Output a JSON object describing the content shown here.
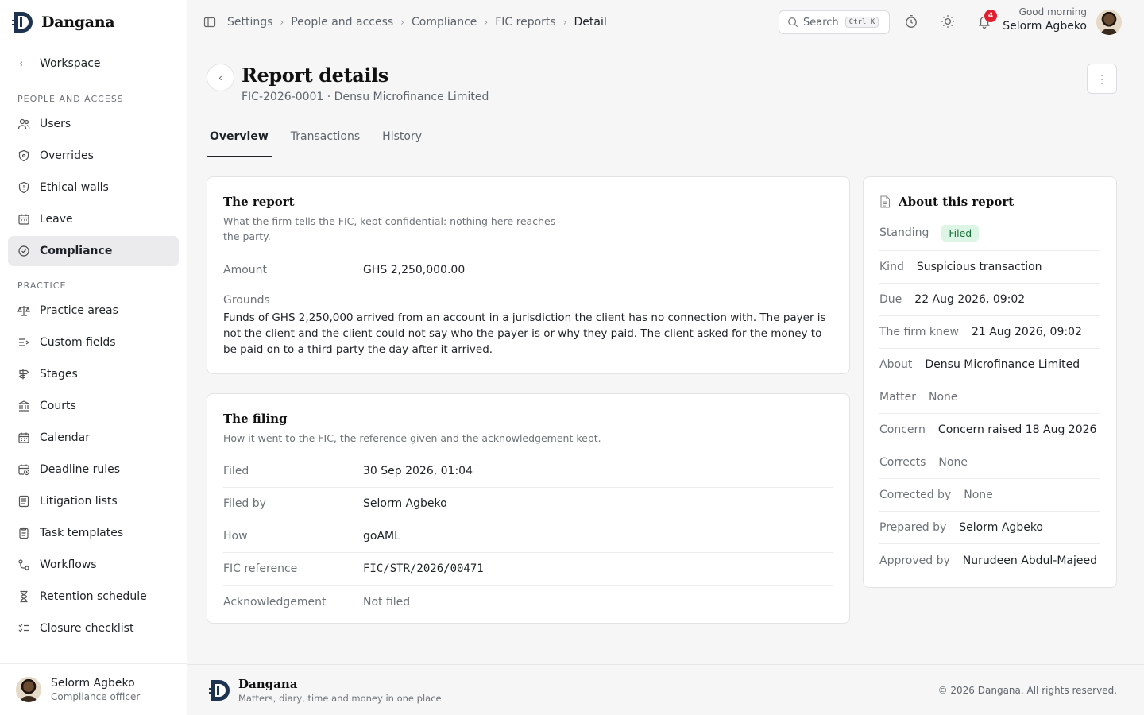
{
  "app": {
    "brand": "Dangana",
    "tagline": "Matters, diary, time and money in one place",
    "copyright": "© 2026 Dangana. All rights reserved."
  },
  "sidebar": {
    "back_label": "Workspace",
    "sections": [
      {
        "label": "PEOPLE AND ACCESS",
        "items": [
          {
            "label": "Users",
            "icon": "users-icon"
          },
          {
            "label": "Overrides",
            "icon": "shield-icon"
          },
          {
            "label": "Ethical walls",
            "icon": "shield-alert-icon"
          },
          {
            "label": "Leave",
            "icon": "calendar-icon"
          },
          {
            "label": "Compliance",
            "icon": "check-circle-icon",
            "active": true
          }
        ]
      },
      {
        "label": "PRACTICE",
        "items": [
          {
            "label": "Practice areas",
            "icon": "scales-icon"
          },
          {
            "label": "Custom fields",
            "icon": "form-icon"
          },
          {
            "label": "Stages",
            "icon": "signpost-icon"
          },
          {
            "label": "Courts",
            "icon": "landmark-icon"
          },
          {
            "label": "Calendar",
            "icon": "calendar-icon"
          },
          {
            "label": "Deadline rules",
            "icon": "calendar-clock-icon"
          },
          {
            "label": "Litigation lists",
            "icon": "list-icon"
          },
          {
            "label": "Task templates",
            "icon": "clipboard-icon"
          },
          {
            "label": "Workflows",
            "icon": "workflow-icon"
          },
          {
            "label": "Retention schedule",
            "icon": "hourglass-icon"
          },
          {
            "label": "Closure checklist",
            "icon": "checklist-icon"
          }
        ]
      }
    ],
    "user": {
      "name": "Selorm Agbeko",
      "role": "Compliance officer"
    }
  },
  "topbar": {
    "breadcrumbs": [
      "Settings",
      "People and access",
      "Compliance",
      "FIC reports",
      "Detail"
    ],
    "search_label": "Search",
    "search_shortcut": "Ctrl K",
    "notifications_count": "4",
    "greeting": "Good morning",
    "user_name": "Selorm Agbeko"
  },
  "page": {
    "title": "Report details",
    "subtitle": "FIC-2026-0001 · Densu Microfinance Limited",
    "tabs": [
      {
        "label": "Overview",
        "active": true
      },
      {
        "label": "Transactions"
      },
      {
        "label": "History"
      }
    ]
  },
  "report_card": {
    "title": "The report",
    "description": "What the firm tells the FIC, kept confidential: nothing here reaches the party.",
    "amount_label": "Amount",
    "amount_value": "GHS 2,250,000.00",
    "grounds_label": "Grounds",
    "grounds_text": "Funds of GHS 2,250,000 arrived from an account in a jurisdiction the client has no connection with. The payer is not the client and the client could not say who the payer is or why they paid. The client asked for the money to be paid on to a third party the day after it arrived."
  },
  "filing_card": {
    "title": "The filing",
    "description": "How it went to the FIC, the reference given and the acknowledgement kept.",
    "rows": [
      {
        "label": "Filed",
        "value": "30 Sep 2026, 01:04"
      },
      {
        "label": "Filed by",
        "value": "Selorm Agbeko",
        "link": true
      },
      {
        "label": "How",
        "value": "goAML"
      },
      {
        "label": "FIC reference",
        "value": "FIC/STR/2026/00471",
        "mono": true
      },
      {
        "label": "Acknowledgement",
        "value": "Not filed",
        "muted": true
      }
    ]
  },
  "about_card": {
    "title": "About this report",
    "standing_label": "Standing",
    "standing_value": "Filed",
    "standing_color": "#dcf5e4",
    "rows": [
      {
        "label": "Kind",
        "value": "Suspicious transaction"
      },
      {
        "label": "Due",
        "value": "22 Aug 2026, 09:02"
      },
      {
        "label": "The firm knew",
        "value": "21 Aug 2026, 09:02"
      },
      {
        "label": "About",
        "value": "Densu Microfinance Limited",
        "link": true
      },
      {
        "label": "Matter",
        "value": "None",
        "muted": true
      },
      {
        "label": "Concern",
        "value": "Concern raised 18 Aug 2026",
        "link": true
      },
      {
        "label": "Corrects",
        "value": "None",
        "muted": true
      },
      {
        "label": "Corrected by",
        "value": "None",
        "muted": true
      },
      {
        "label": "Prepared by",
        "value": "Selorm Agbeko",
        "link": true
      },
      {
        "label": "Approved by",
        "value": "Nurudeen Abdul-Majeed",
        "link": true
      }
    ]
  },
  "colors": {
    "link": "#2b5bb5",
    "accent": "#1f2328",
    "badge": "#e11d2e"
  }
}
